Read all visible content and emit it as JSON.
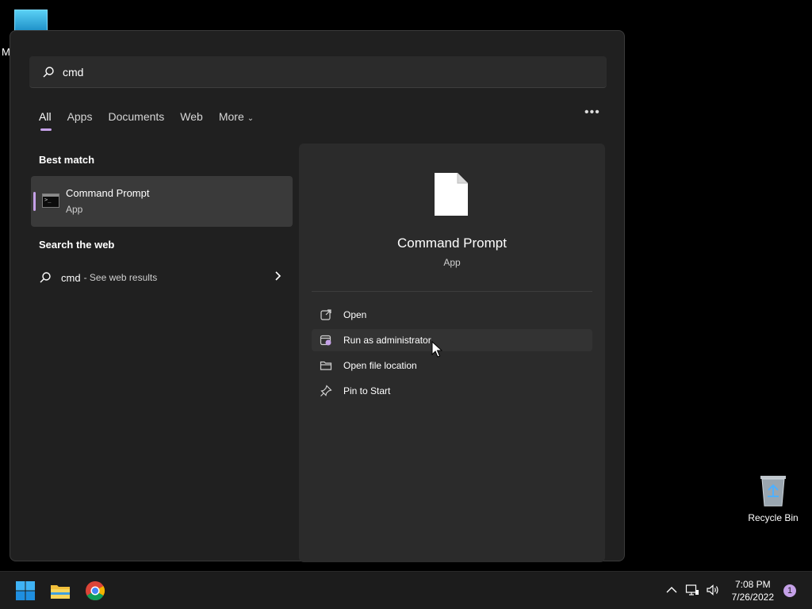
{
  "desktop": {
    "truncated_label": "M",
    "recycle_bin_label": "Recycle Bin"
  },
  "search": {
    "query": "cmd"
  },
  "tabs": [
    {
      "label": "All",
      "active": true
    },
    {
      "label": "Apps"
    },
    {
      "label": "Documents"
    },
    {
      "label": "Web"
    },
    {
      "label": "More"
    }
  ],
  "best_match": {
    "heading": "Best match",
    "title": "Command Prompt",
    "subtitle": "App"
  },
  "web_search": {
    "heading": "Search the web",
    "query": "cmd",
    "hint": "- See web results"
  },
  "preview": {
    "title": "Command Prompt",
    "subtitle": "App",
    "actions": [
      {
        "label": "Open",
        "icon": "open-external-icon"
      },
      {
        "label": "Run as administrator",
        "icon": "shield-admin-icon"
      },
      {
        "label": "Open file location",
        "icon": "folder-icon"
      },
      {
        "label": "Pin to Start",
        "icon": "pin-icon"
      }
    ]
  },
  "taskbar": {
    "time": "7:08 PM",
    "date": "7/26/2022",
    "notification_count": "1"
  },
  "colors": {
    "accent": "#c5a1e8",
    "panel": "#202020",
    "preview": "#2b2b2b"
  }
}
